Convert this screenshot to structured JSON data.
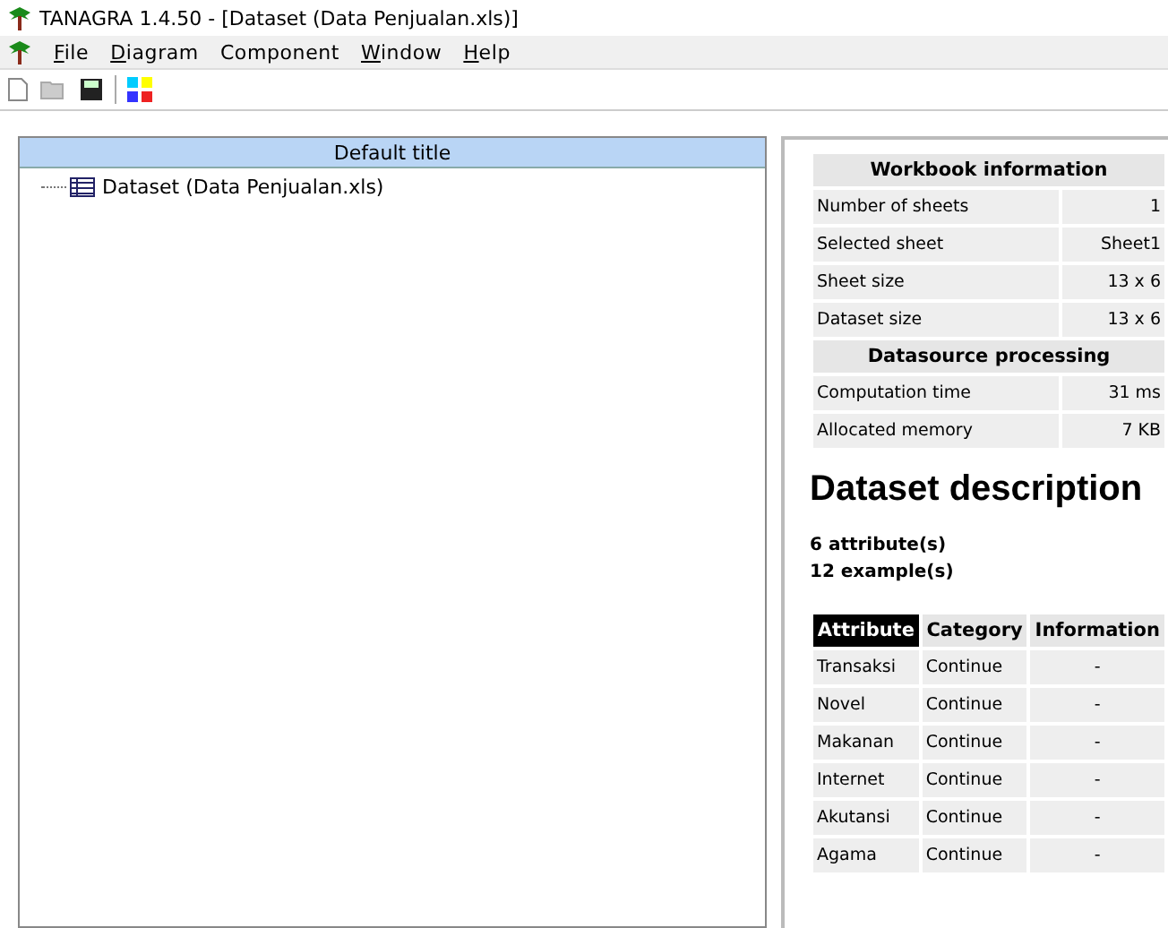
{
  "window": {
    "title": "TANAGRA 1.4.50 - [Dataset (Data Penjualan.xls)]"
  },
  "menu": [
    {
      "label": "File",
      "underlined": true
    },
    {
      "label": "Diagram",
      "underlined": true
    },
    {
      "label": "Component",
      "underlined": false
    },
    {
      "label": "Window",
      "underlined": true
    },
    {
      "label": "Help",
      "underlined": true
    }
  ],
  "tree": {
    "title": "Default title",
    "items": [
      {
        "label": "Dataset (Data Penjualan.xls)"
      }
    ]
  },
  "report": {
    "workbook": {
      "title": "Workbook information",
      "rows": [
        [
          "Number of sheets",
          "1"
        ],
        [
          "Selected sheet",
          "Sheet1"
        ],
        [
          "Sheet size",
          "13 x 6"
        ],
        [
          "Dataset size",
          "13 x 6"
        ]
      ]
    },
    "processing": {
      "title": "Datasource processing",
      "rows": [
        [
          "Computation time",
          "31 ms"
        ],
        [
          "Allocated memory",
          "7 KB"
        ]
      ]
    },
    "heading": "Dataset description",
    "summary": [
      "6 attribute(s)",
      "12 example(s)"
    ],
    "columns": [
      {
        "label": "Attribute",
        "highlighted": true
      },
      {
        "label": "Category",
        "highlighted": false
      },
      {
        "label": "Information",
        "highlighted": false
      }
    ],
    "rows": [
      [
        "Transaksi",
        "Continue",
        "-"
      ],
      [
        "Novel",
        "Continue",
        "-"
      ],
      [
        "Makanan",
        "Continue",
        "-"
      ],
      [
        "Internet",
        "Continue",
        "-"
      ],
      [
        "Akutansi",
        "Continue",
        "-"
      ],
      [
        "Agama",
        "Continue",
        "-"
      ]
    ]
  }
}
